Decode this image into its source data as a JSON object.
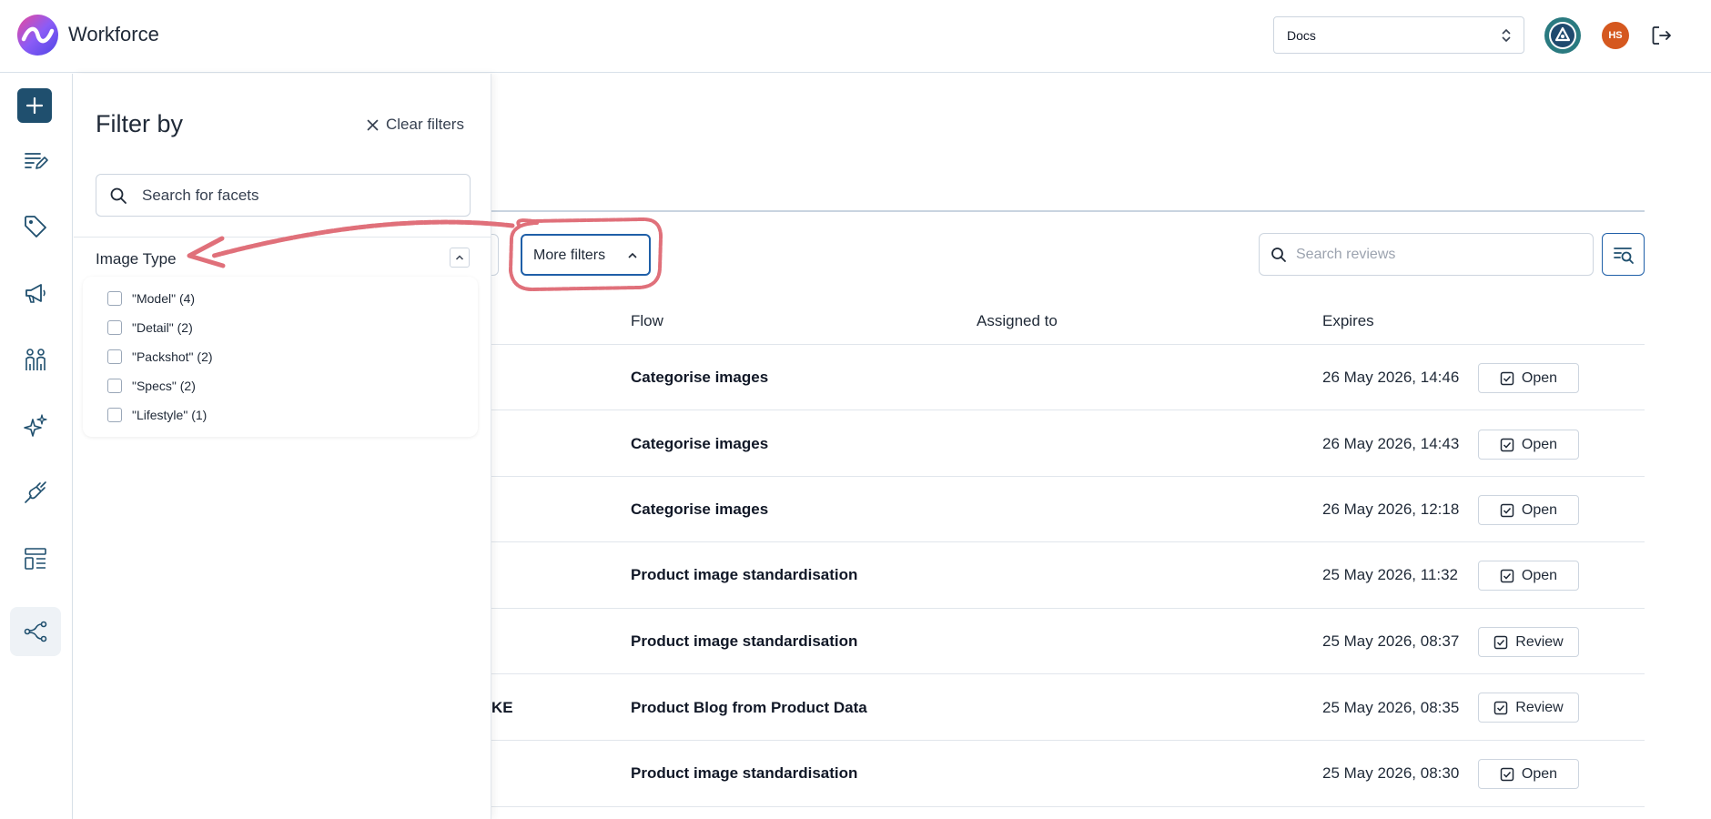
{
  "header": {
    "app_title": "Workforce",
    "workspace_selected": "Docs",
    "user_initials": "HS"
  },
  "toolbar": {
    "more_filters_label": "More filters",
    "search_reviews_placeholder": "Search reviews"
  },
  "table": {
    "columns": [
      "Flow",
      "Assigned to",
      "Expires"
    ],
    "rows": [
      {
        "name_fragment": "",
        "flow": "Categorise images",
        "assigned_to": "",
        "expires": "26 May 2026, 14:46",
        "action": "Open"
      },
      {
        "name_fragment": "",
        "flow": "Categorise images",
        "assigned_to": "",
        "expires": "26 May 2026, 14:43",
        "action": "Open"
      },
      {
        "name_fragment": "",
        "flow": "Categorise images",
        "assigned_to": "",
        "expires": "26 May 2026, 12:18",
        "action": "Open"
      },
      {
        "name_fragment": "",
        "flow": "Product image standardisation",
        "assigned_to": "",
        "expires": "25 May 2026, 11:32",
        "action": "Open"
      },
      {
        "name_fragment": "",
        "flow": "Product image standardisation",
        "assigned_to": "",
        "expires": "25 May 2026, 08:37",
        "action": "Review"
      },
      {
        "name_fragment": "KE",
        "flow": "Product Blog from Product Data",
        "assigned_to": "",
        "expires": "25 May 2026, 08:35",
        "action": "Review"
      },
      {
        "name_fragment": "",
        "flow": "Product image standardisation",
        "assigned_to": "",
        "expires": "25 May 2026, 08:30",
        "action": "Open"
      }
    ]
  },
  "filter_panel": {
    "title": "Filter by",
    "clear_label": "Clear filters",
    "search_placeholder": "Search for facets",
    "facet": {
      "name": "Image Type",
      "options": [
        "\"Model\" (4)",
        "\"Detail\" (2)",
        "\"Packshot\" (2)",
        "\"Specs\" (2)",
        "\"Lifestyle\" (1)"
      ]
    }
  },
  "colors": {
    "primary": "#1f5fa8",
    "rail_add": "#1f4f6e",
    "avatar_user": "#d5581f",
    "annotation": "#e0707a"
  }
}
